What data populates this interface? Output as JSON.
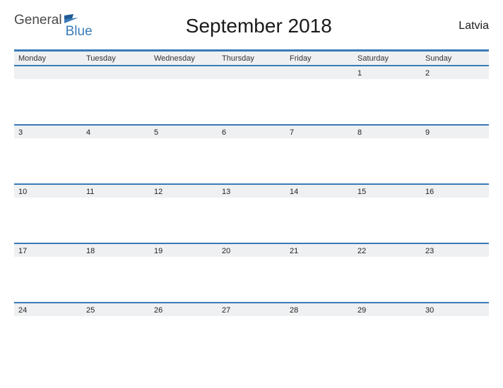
{
  "brand": {
    "word1": "General",
    "word2": "Blue",
    "colors": {
      "accent": "#3a7ab8",
      "dark_accent": "#1f5a94"
    }
  },
  "title": "September 2018",
  "region": "Latvia",
  "days_of_week": [
    "Monday",
    "Tuesday",
    "Wednesday",
    "Thursday",
    "Friday",
    "Saturday",
    "Sunday"
  ],
  "weeks": [
    [
      "",
      "",
      "",
      "",
      "",
      "1",
      "2"
    ],
    [
      "3",
      "4",
      "5",
      "6",
      "7",
      "8",
      "9"
    ],
    [
      "10",
      "11",
      "12",
      "13",
      "14",
      "15",
      "16"
    ],
    [
      "17",
      "18",
      "19",
      "20",
      "21",
      "22",
      "23"
    ],
    [
      "24",
      "25",
      "26",
      "27",
      "28",
      "29",
      "30"
    ]
  ]
}
